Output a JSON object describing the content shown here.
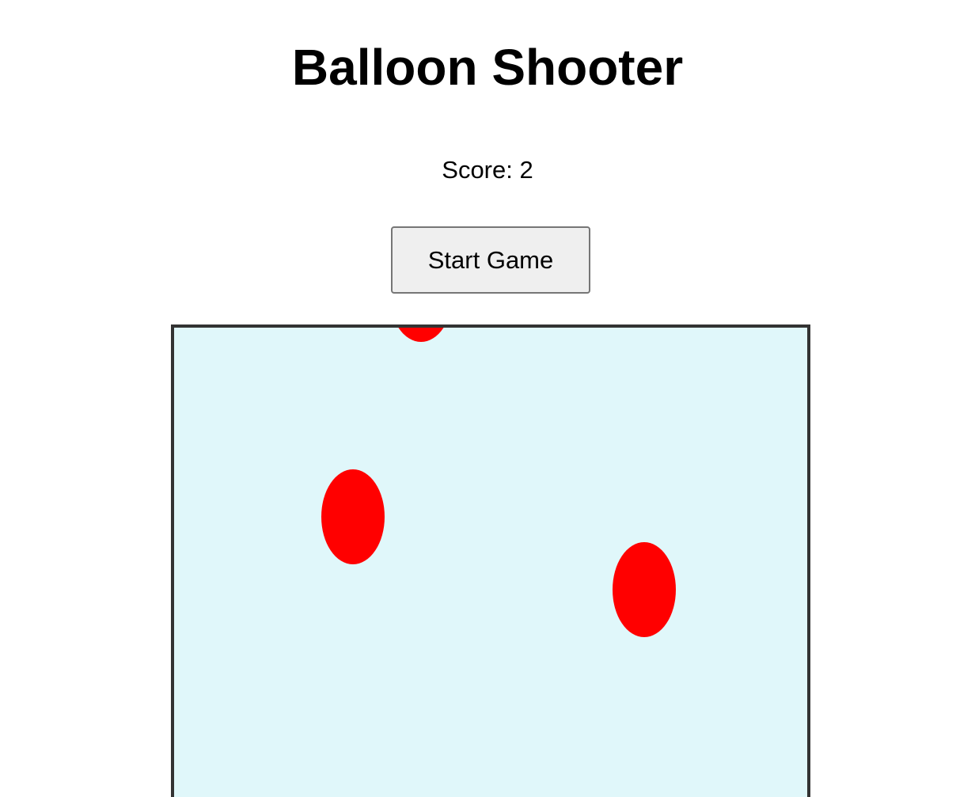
{
  "title": "Balloon Shooter",
  "score": {
    "text": "Score: 2",
    "value": 2
  },
  "start_button": {
    "label": "Start Game"
  },
  "game_area": {
    "background_color": "#e0f7fa",
    "border_color": "#333333",
    "balloons": [
      {
        "color": "#ff0000"
      },
      {
        "color": "#ff0000"
      },
      {
        "color": "#ff0000"
      }
    ]
  }
}
